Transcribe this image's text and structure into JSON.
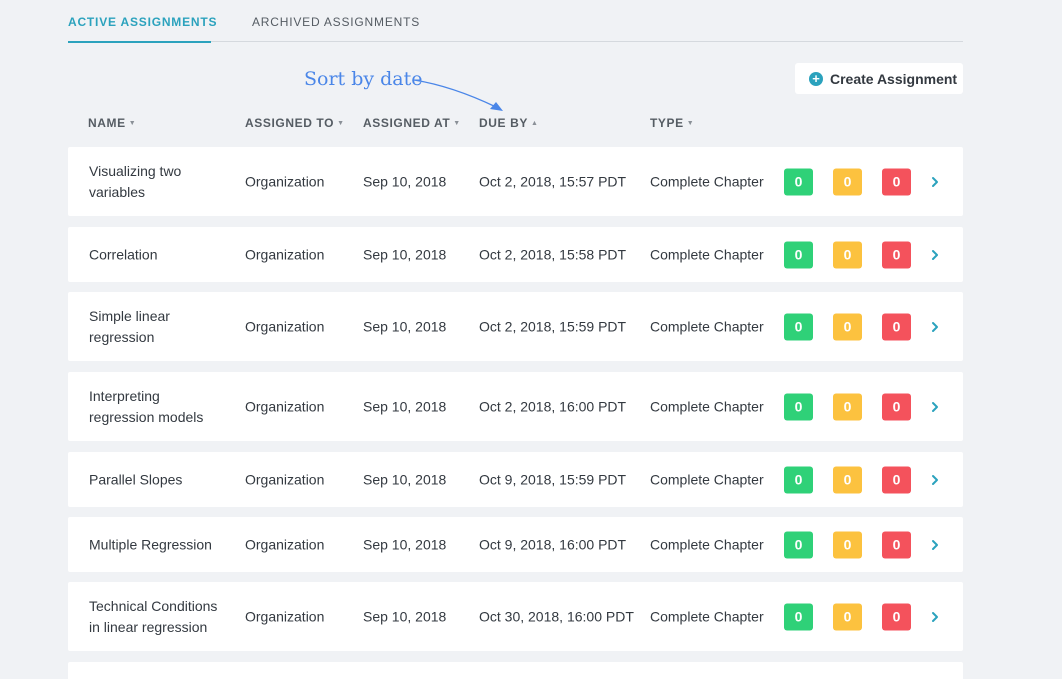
{
  "tabs": {
    "active": "ACTIVE ASSIGNMENTS",
    "archived": "ARCHIVED ASSIGNMENTS"
  },
  "annotation": "Sort by date",
  "create_button": "Create Assignment",
  "columns": {
    "name": "NAME",
    "assigned_to": "ASSIGNED TO",
    "assigned_at": "ASSIGNED AT",
    "due_by": "DUE BY",
    "type": "TYPE"
  },
  "colors": {
    "accent": "#2ba2bd",
    "green": "#2fd178",
    "yellow": "#fcc23f",
    "red": "#f4525c",
    "annotation": "#4a86e8"
  },
  "rows": [
    {
      "name": "Visualizing two variables",
      "assigned_to": "Organization",
      "assigned_at": "Sep 10, 2018",
      "due_by": "Oct 2, 2018, 15:57 PDT",
      "type": "Complete Chapter",
      "green": "0",
      "yellow": "0",
      "red": "0"
    },
    {
      "name": "Correlation",
      "assigned_to": "Organization",
      "assigned_at": "Sep 10, 2018",
      "due_by": "Oct 2, 2018, 15:58 PDT",
      "type": "Complete Chapter",
      "green": "0",
      "yellow": "0",
      "red": "0"
    },
    {
      "name": "Simple linear regression",
      "assigned_to": "Organization",
      "assigned_at": "Sep 10, 2018",
      "due_by": "Oct 2, 2018, 15:59 PDT",
      "type": "Complete Chapter",
      "green": "0",
      "yellow": "0",
      "red": "0"
    },
    {
      "name": "Interpreting regression models",
      "assigned_to": "Organization",
      "assigned_at": "Sep 10, 2018",
      "due_by": "Oct 2, 2018, 16:00 PDT",
      "type": "Complete Chapter",
      "green": "0",
      "yellow": "0",
      "red": "0"
    },
    {
      "name": "Parallel Slopes",
      "assigned_to": "Organization",
      "assigned_at": "Sep 10, 2018",
      "due_by": "Oct 9, 2018, 15:59 PDT",
      "type": "Complete Chapter",
      "green": "0",
      "yellow": "0",
      "red": "0"
    },
    {
      "name": "Multiple Regression",
      "assigned_to": "Organization",
      "assigned_at": "Sep 10, 2018",
      "due_by": "Oct 9, 2018, 16:00 PDT",
      "type": "Complete Chapter",
      "green": "0",
      "yellow": "0",
      "red": "0"
    },
    {
      "name": "Technical Conditions in linear regression",
      "assigned_to": "Organization",
      "assigned_at": "Sep 10, 2018",
      "due_by": "Oct 30, 2018, 16:00 PDT",
      "type": "Complete Chapter",
      "green": "0",
      "yellow": "0",
      "red": "0"
    }
  ]
}
